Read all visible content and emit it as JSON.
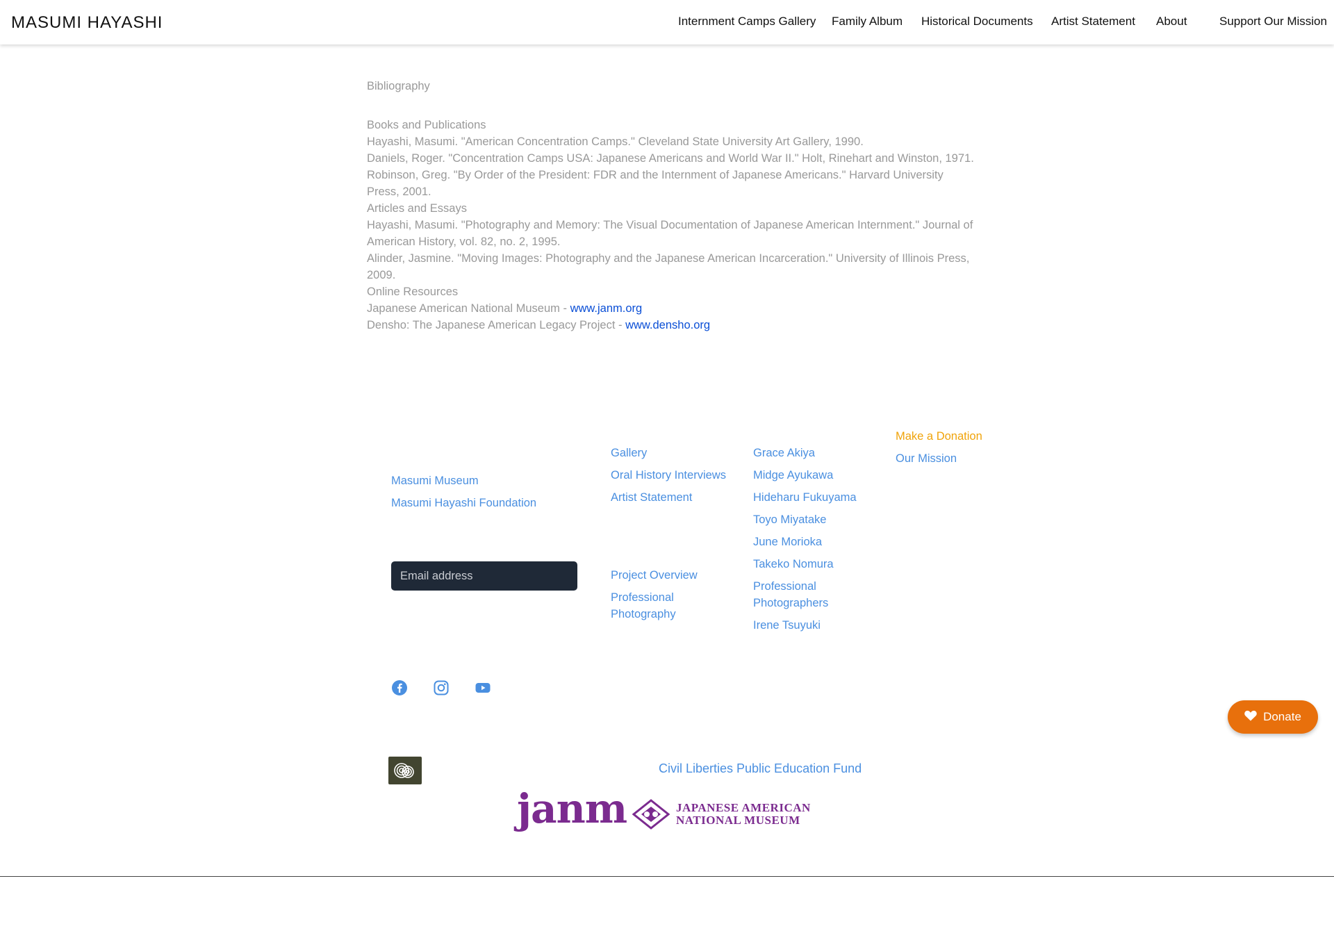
{
  "brand": "MASUMI HAYASHI",
  "nav": {
    "items": [
      "Internment Camps Gallery",
      "Family Album",
      "Historical Documents",
      "Artist Statement",
      "About",
      "Support Our Mission"
    ]
  },
  "bibliography": {
    "title": "Bibliography",
    "lines": [
      "Books and Publications",
      "Hayashi, Masumi. \"American Concentration Camps.\" Cleveland State University Art Gallery, 1990.",
      "Daniels, Roger. \"Concentration Camps USA: Japanese Americans and World War II.\" Holt, Rinehart and Winston, 1971.",
      "Robinson, Greg. \"By Order of the President: FDR and the Internment of Japanese Americans.\" Harvard University Press, 2001.",
      "Articles and Essays",
      "Hayashi, Masumi. \"Photography and Memory: The Visual Documentation of Japanese American Internment.\" Journal of American History, vol. 82, no. 2, 1995.",
      "Alinder, Jasmine. \"Moving Images: Photography and the Japanese American Incarceration.\" University of Illinois Press, 2009.",
      "Online Resources"
    ],
    "resources": [
      {
        "label": "Japanese American National Museum - ",
        "link": "www.janm.org"
      },
      {
        "label": "Densho: The Japanese American Legacy Project - ",
        "link": "www.densho.org"
      }
    ]
  },
  "footer": {
    "col1": [
      "Masumi Museum",
      "Masumi Hayashi Foundation"
    ],
    "email_placeholder": "Email address",
    "col2_top": [
      "Gallery",
      "Oral History Interviews",
      "Artist Statement"
    ],
    "col2_bottom": [
      "Project Overview",
      "Professional Photography"
    ],
    "col3": [
      "Grace Akiya",
      "Midge Ayukawa",
      "Hideharu Fukuyama",
      "Toyo Miyatake",
      "June Morioka",
      "Takeko Nomura",
      "Professional Photographers",
      "Irene Tsuyuki"
    ],
    "col4": [
      "Make a Donation",
      "Our Mission"
    ],
    "social": [
      "facebook-icon",
      "instagram-icon",
      "youtube-icon"
    ],
    "clpef": "Civil Liberties Public Education Fund",
    "janm_word": "janm",
    "janm_text": [
      "JAPANESE AMERICAN",
      "NATIONAL MUSEUM"
    ]
  },
  "donate_button": "Donate",
  "colors": {
    "link_blue": "#4a8fe0",
    "anchor_blue": "#0b4fd6",
    "donation_orange": "#f0a30a",
    "donate_button": "#e8700c",
    "janm_purple": "#7b2b8f"
  }
}
